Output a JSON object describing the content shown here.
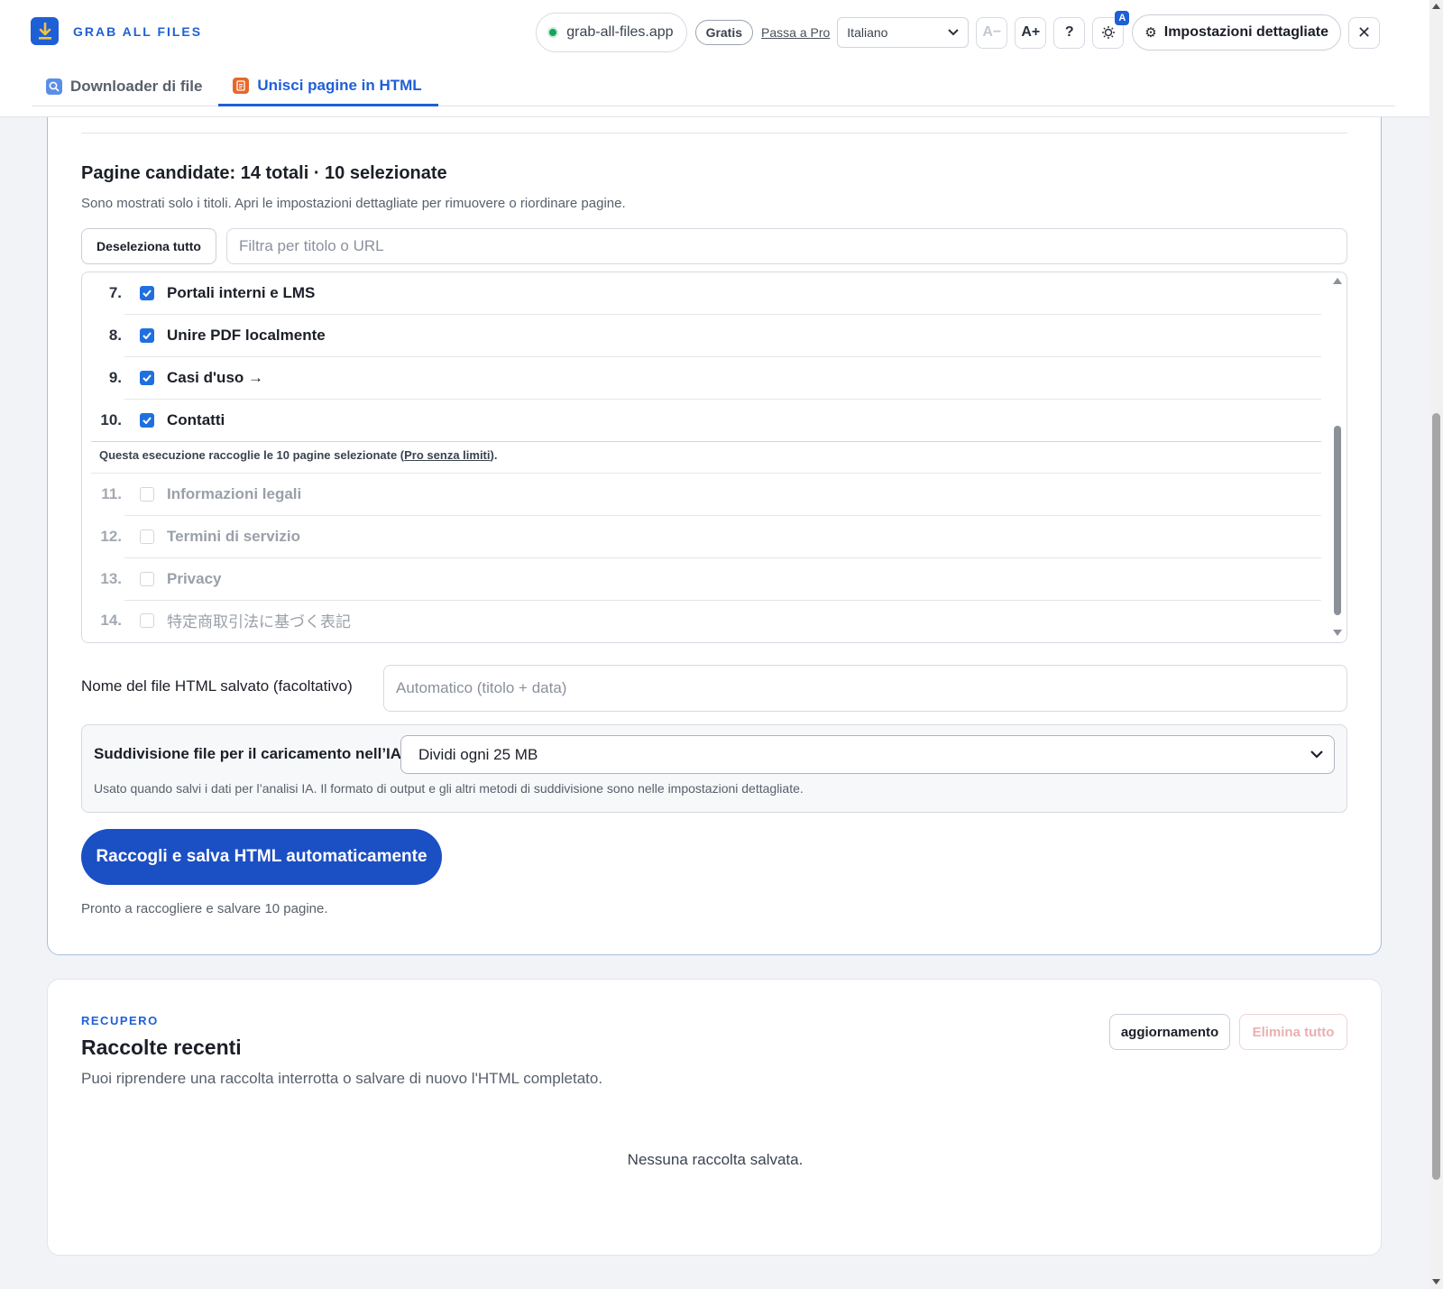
{
  "header": {
    "brand": "GRAB ALL FILES",
    "domain": "grab-all-files.app",
    "plan": "Gratis",
    "upgrade": "Passa a Pro",
    "language": "Italiano",
    "font_decrease": "A−",
    "font_increase": "A+",
    "help": "?",
    "theme_badge": "A",
    "settings": "Impostazioni dettagliate",
    "close": "✕"
  },
  "tabs": [
    {
      "label": "Downloader di file",
      "active": false
    },
    {
      "label": "Unisci pagine in HTML",
      "active": true
    }
  ],
  "candidates": {
    "title": "Pagine candidate: 14 totali · 10 selezionate",
    "subtitle": "Sono mostrati solo i titoli. Apri le impostazioni dettagliate per rimuovere o riordinare pagine.",
    "deselect_all": "Deseleziona tutto",
    "filter_placeholder": "Filtra per titolo o URL",
    "pages": [
      {
        "num": "7.",
        "title": "Portali interni e LMS",
        "checked": true
      },
      {
        "num": "8.",
        "title": "Unire PDF localmente",
        "checked": true
      },
      {
        "num": "9.",
        "title": "Casi d'uso →",
        "checked": true
      },
      {
        "num": "10.",
        "title": "Contatti",
        "checked": true
      },
      {
        "num": "11.",
        "title": "Informazioni legali",
        "checked": false
      },
      {
        "num": "12.",
        "title": "Termini di servizio",
        "checked": false
      },
      {
        "num": "13.",
        "title": "Privacy",
        "checked": false
      },
      {
        "num": "14.",
        "title": "特定商取引法に基づく表記",
        "checked": false
      }
    ],
    "limit_note_prefix": "Questa esecuzione raccoglie le 10 pagine selezionate (",
    "limit_note_link": "Pro senza limiti",
    "limit_note_suffix": ")."
  },
  "filename": {
    "label": "Nome del file HTML salvato (facoltativo)",
    "placeholder": "Automatico (titolo + data)"
  },
  "split": {
    "label": "Suddivisione file per il caricamento nell’IA",
    "value": "Dividi ogni 25 MB",
    "help": "Usato quando salvi i dati per l’analisi IA. Il formato di output e gli altri metodi di suddivisione sono nelle impostazioni dettagliate."
  },
  "action": {
    "button": "Raccogli e salva HTML automaticamente",
    "status": "Pronto a raccogliere e salvare 10 pagine."
  },
  "recovery": {
    "eyebrow": "RECUPERO",
    "title": "Raccolte recenti",
    "subtitle": "Puoi riprendere una raccolta interrotta o salvare di nuovo l'HTML completato.",
    "refresh": "aggiornamento",
    "delete_all": "Elimina tutto",
    "empty": "Nessuna raccolta salvata."
  },
  "colors": {
    "accent": "#1f5fd6",
    "cta": "#1b4fc4",
    "checkbox": "#1f6fe0",
    "online_dot": "#17a55a"
  }
}
